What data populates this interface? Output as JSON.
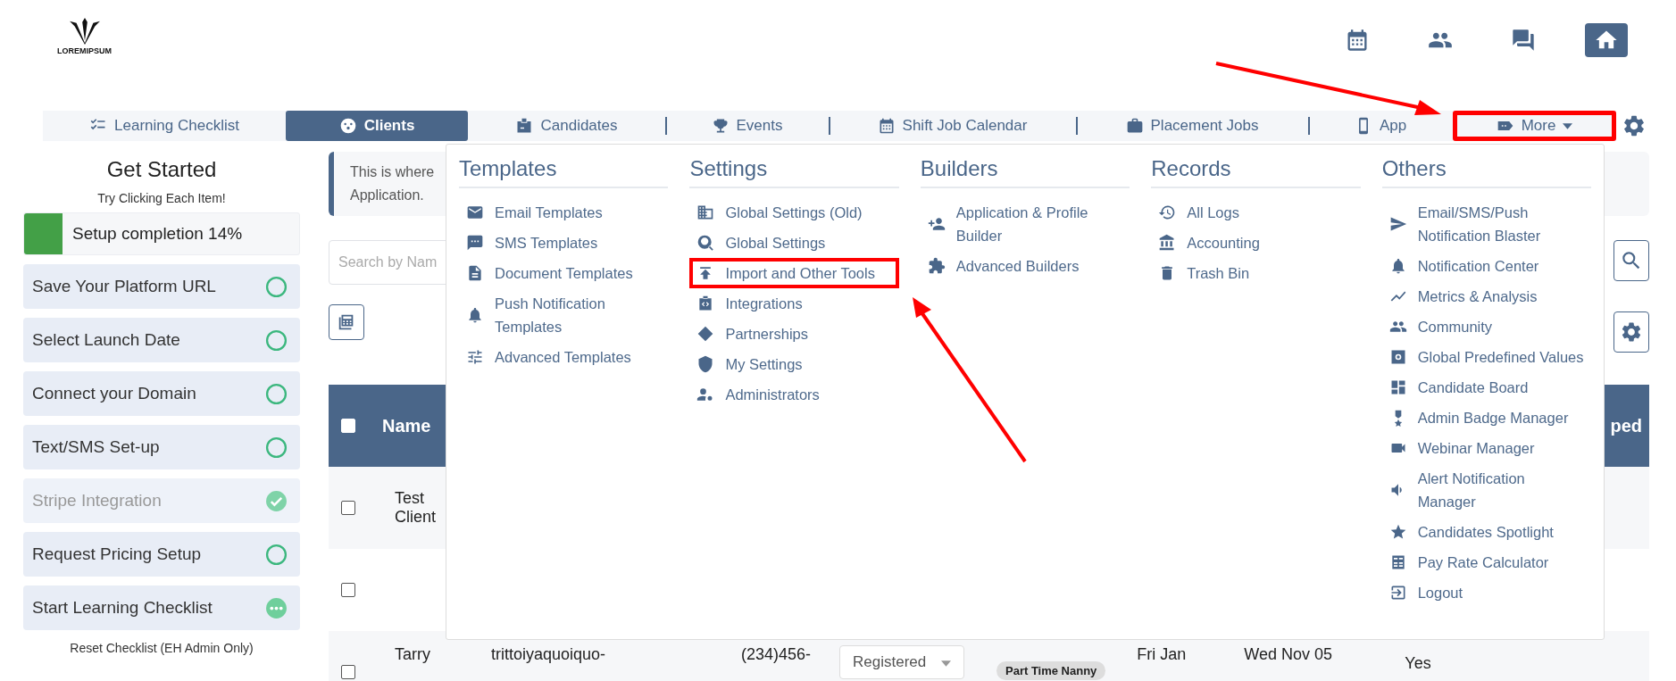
{
  "logo": {
    "text": "LOREMIPSUM"
  },
  "header_buttons": [
    {
      "selected": false
    },
    {
      "selected": false
    },
    {
      "selected": false
    },
    {
      "selected": true
    }
  ],
  "nav_tabs": [
    {
      "label": "Learning Checklist",
      "selected": false,
      "divider": false,
      "highlighted": false,
      "dropdown": false
    },
    {
      "label": "Clients",
      "selected": true,
      "divider": false,
      "highlighted": false,
      "dropdown": false
    },
    {
      "label": "Candidates",
      "selected": false,
      "divider": false,
      "highlighted": false,
      "dropdown": false
    },
    {
      "label": "Events",
      "selected": false,
      "divider": true,
      "highlighted": false,
      "dropdown": false
    },
    {
      "label": "Shift Job Calendar",
      "selected": false,
      "divider": true,
      "highlighted": false,
      "dropdown": false
    },
    {
      "label": "Placement Jobs",
      "selected": false,
      "divider": true,
      "highlighted": false,
      "dropdown": false
    },
    {
      "label": "App",
      "selected": false,
      "divider": true,
      "highlighted": false,
      "dropdown": false
    },
    {
      "label": "More",
      "selected": false,
      "divider": false,
      "highlighted": true,
      "dropdown": true
    }
  ],
  "sidebar": {
    "title": "Get Started",
    "subtitle": "Try Clicking Each Item!",
    "progress": {
      "label": "Setup completion 14%",
      "level": 0.14
    },
    "items": [
      {
        "label": "Save Your Platform URL",
        "kind": "todo"
      },
      {
        "label": "Select Launch Date",
        "kind": "todo"
      },
      {
        "label": "Connect your Domain",
        "kind": "todo"
      },
      {
        "label": "Text/SMS Set-up",
        "kind": "todo"
      },
      {
        "label": "Stripe Integration",
        "kind": "done"
      },
      {
        "label": "Request Pricing Setup",
        "kind": "todo"
      },
      {
        "label": "Start Learning Checklist",
        "kind": "pending"
      }
    ],
    "reset_link": "Reset Checklist (EH Admin Only)"
  },
  "info_box": {
    "lines": [
      "This is where",
      "Application."
    ]
  },
  "search": {
    "placeholder": "Search by Nam"
  },
  "table": {
    "header_checked": false,
    "columns": [
      "Name",
      "ped"
    ],
    "rows": [
      {
        "checked": false,
        "cells": [
          "Test Client"
        ]
      },
      {
        "checked": false,
        "cells": []
      },
      {
        "checked": false,
        "cells": [
          "Tarry",
          "trittoiyaquoiquo-",
          "(234)456-",
          "Registered",
          "Part Time Nanny",
          "Fri Jan",
          "Wed Nov 05",
          "Yes"
        ]
      }
    ]
  },
  "menu": {
    "columns": [
      {
        "heading": "Templates",
        "items": [
          {
            "label": "Email Templates",
            "highlighted": false
          },
          {
            "label": "SMS Templates",
            "highlighted": false
          },
          {
            "label": "Document Templates",
            "highlighted": false
          },
          {
            "label": "Push Notification Templates",
            "highlighted": false
          },
          {
            "label": "Advanced Templates",
            "highlighted": false
          }
        ]
      },
      {
        "heading": "Settings",
        "items": [
          {
            "label": "Global Settings (Old)",
            "highlighted": false
          },
          {
            "label": "Global Settings",
            "highlighted": false
          },
          {
            "label": "Import and Other Tools",
            "highlighted": true
          },
          {
            "label": "Integrations",
            "highlighted": false
          },
          {
            "label": "Partnerships",
            "highlighted": false
          },
          {
            "label": "My Settings",
            "highlighted": false
          },
          {
            "label": "Administrators",
            "highlighted": false
          }
        ]
      },
      {
        "heading": "Builders",
        "items": [
          {
            "label": "Application & Profile Builder",
            "highlighted": false
          },
          {
            "label": "Advanced Builders",
            "highlighted": false
          }
        ]
      },
      {
        "heading": "Records",
        "items": [
          {
            "label": "All Logs",
            "highlighted": false
          },
          {
            "label": "Accounting",
            "highlighted": false
          },
          {
            "label": "Trash Bin",
            "highlighted": false
          }
        ]
      },
      {
        "heading": "Others",
        "items": [
          {
            "label": "Email/SMS/Push Notification Blaster",
            "highlighted": false
          },
          {
            "label": "Notification Center",
            "highlighted": false
          },
          {
            "label": "Metrics & Analysis",
            "highlighted": false
          },
          {
            "label": "Community",
            "highlighted": false
          },
          {
            "label": "Global Predefined Values",
            "highlighted": false
          },
          {
            "label": "Candidate Board",
            "highlighted": false
          },
          {
            "label": "Admin Badge Manager",
            "highlighted": false
          },
          {
            "label": "Webinar Manager",
            "highlighted": false
          },
          {
            "label": "Alert Notification Manager",
            "highlighted": false
          },
          {
            "label": "Candidates Spotlight",
            "highlighted": false
          },
          {
            "label": "Pay Rate Calculator",
            "highlighted": false
          },
          {
            "label": "Logout",
            "highlighted": false
          }
        ]
      }
    ]
  }
}
